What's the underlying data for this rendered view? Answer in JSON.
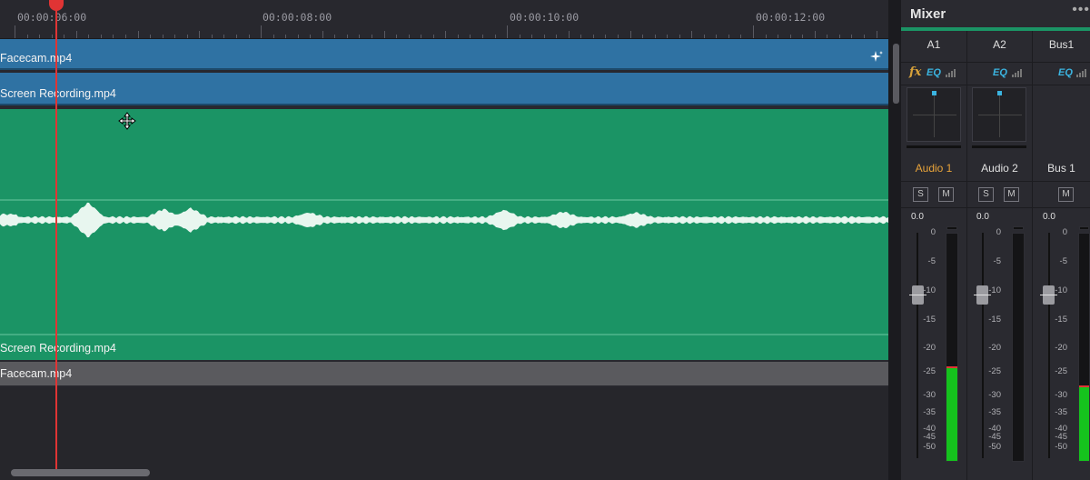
{
  "timeline": {
    "timecodes": [
      "00:00:06:00",
      "00:00:08:00",
      "00:00:10:00",
      "00:00:12:00"
    ],
    "tracks": {
      "video1": "Facecam.mp4",
      "video2": "Screen Recording.mp4",
      "audio1": "Screen Recording.mp4",
      "audio2": "Facecam.mp4"
    },
    "colors": {
      "video_clip": "#2f72a3",
      "audio_clip": "#1b9465",
      "playhead": "#e03434"
    }
  },
  "mixer": {
    "title": "Mixer",
    "menu": "•••",
    "channels": [
      {
        "id": "A1",
        "track": "Audio 1",
        "volume": "0.0",
        "has_fx": true,
        "fx": "fx",
        "eq": "EQ",
        "active": true
      },
      {
        "id": "A2",
        "track": "Audio 2",
        "volume": "0.0",
        "has_fx": false,
        "eq": "EQ",
        "active": false
      },
      {
        "id": "Bus1",
        "track": "Bus 1",
        "volume": "0.0",
        "has_fx": false,
        "eq": "EQ",
        "active": false
      }
    ],
    "solo_label": "S",
    "mute_label": "M",
    "scale": [
      "0",
      "-5",
      "-10",
      "-15",
      "-20",
      "-25",
      "-30",
      "-35",
      "-40",
      "-45",
      "-50"
    ],
    "meter_level_db": -22,
    "meter_level_bus_db": -26
  }
}
